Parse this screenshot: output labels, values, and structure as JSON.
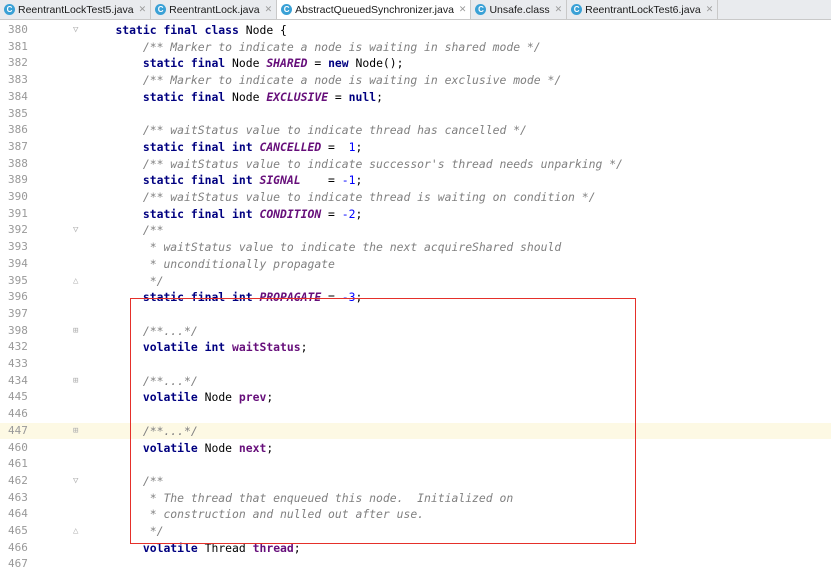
{
  "tabs": [
    {
      "label": "ReentrantLockTest5.java",
      "icon": "class-icon",
      "icon_letter": "C",
      "icon_color": "#3aa1d6",
      "active": false
    },
    {
      "label": "ReentrantLock.java",
      "icon": "class-icon",
      "icon_letter": "C",
      "icon_color": "#3aa1d6",
      "active": false
    },
    {
      "label": "AbstractQueuedSynchronizer.java",
      "icon": "class-icon",
      "icon_letter": "C",
      "icon_color": "#3aa1d6",
      "active": true
    },
    {
      "label": "Unsafe.class",
      "icon": "class-icon",
      "icon_letter": "C",
      "icon_color": "#3aa1d6",
      "active": false
    },
    {
      "label": "ReentrantLockTest6.java",
      "icon": "class-icon",
      "icon_letter": "C",
      "icon_color": "#3aa1d6",
      "active": false
    }
  ],
  "colors": {
    "keyword": "#000080",
    "comment": "#808080",
    "field": "#660e7a",
    "number": "#0000ff",
    "line_number": "#999999",
    "current_line": "#fdf9e4",
    "annotation_box": "#e5302a"
  },
  "lines": [
    {
      "num": "380",
      "fold": "open",
      "highlight": false,
      "tokens": [
        [
          "pl",
          "    "
        ],
        [
          "kw",
          "static final class"
        ],
        [
          "pl",
          " Node {"
        ]
      ]
    },
    {
      "num": "381",
      "fold": "",
      "highlight": false,
      "tokens": [
        [
          "pl",
          "        "
        ],
        [
          "cm",
          "/** Marker to indicate a node is waiting in shared mode */"
        ]
      ]
    },
    {
      "num": "382",
      "fold": "",
      "highlight": false,
      "tokens": [
        [
          "pl",
          "        "
        ],
        [
          "kw",
          "static final"
        ],
        [
          "pl",
          " Node "
        ],
        [
          "fs",
          "SHARED"
        ],
        [
          "pl",
          " = "
        ],
        [
          "kw",
          "new"
        ],
        [
          "pl",
          " Node();"
        ]
      ]
    },
    {
      "num": "383",
      "fold": "",
      "highlight": false,
      "tokens": [
        [
          "pl",
          "        "
        ],
        [
          "cm",
          "/** Marker to indicate a node is waiting in exclusive mode */"
        ]
      ]
    },
    {
      "num": "384",
      "fold": "",
      "highlight": false,
      "tokens": [
        [
          "pl",
          "        "
        ],
        [
          "kw",
          "static final"
        ],
        [
          "pl",
          " Node "
        ],
        [
          "fs",
          "EXCLUSIVE"
        ],
        [
          "pl",
          " = "
        ],
        [
          "kw",
          "null"
        ],
        [
          "pl",
          ";"
        ]
      ]
    },
    {
      "num": "385",
      "fold": "",
      "highlight": false,
      "tokens": []
    },
    {
      "num": "386",
      "fold": "",
      "highlight": false,
      "tokens": [
        [
          "pl",
          "        "
        ],
        [
          "cm",
          "/** waitStatus value to indicate thread has cancelled */"
        ]
      ]
    },
    {
      "num": "387",
      "fold": "",
      "highlight": false,
      "tokens": [
        [
          "pl",
          "        "
        ],
        [
          "kw",
          "static final int"
        ],
        [
          "pl",
          " "
        ],
        [
          "fs",
          "CANCELLED"
        ],
        [
          "pl",
          " =  "
        ],
        [
          "nm",
          "1"
        ],
        [
          "pl",
          ";"
        ]
      ]
    },
    {
      "num": "388",
      "fold": "",
      "highlight": false,
      "tokens": [
        [
          "pl",
          "        "
        ],
        [
          "cm",
          "/** waitStatus value to indicate successor's thread needs unparking */"
        ]
      ]
    },
    {
      "num": "389",
      "fold": "",
      "highlight": false,
      "tokens": [
        [
          "pl",
          "        "
        ],
        [
          "kw",
          "static final int"
        ],
        [
          "pl",
          " "
        ],
        [
          "fs",
          "SIGNAL"
        ],
        [
          "pl",
          "    = "
        ],
        [
          "nm",
          "-1"
        ],
        [
          "pl",
          ";"
        ]
      ]
    },
    {
      "num": "390",
      "fold": "",
      "highlight": false,
      "tokens": [
        [
          "pl",
          "        "
        ],
        [
          "cm",
          "/** waitStatus value to indicate thread is waiting on condition */"
        ]
      ]
    },
    {
      "num": "391",
      "fold": "",
      "highlight": false,
      "tokens": [
        [
          "pl",
          "        "
        ],
        [
          "kw",
          "static final int"
        ],
        [
          "pl",
          " "
        ],
        [
          "fs",
          "CONDITION"
        ],
        [
          "pl",
          " = "
        ],
        [
          "nm",
          "-2"
        ],
        [
          "pl",
          ";"
        ]
      ]
    },
    {
      "num": "392",
      "fold": "open",
      "highlight": false,
      "tokens": [
        [
          "pl",
          "        "
        ],
        [
          "cm",
          "/**"
        ]
      ]
    },
    {
      "num": "393",
      "fold": "",
      "highlight": false,
      "tokens": [
        [
          "pl",
          "         "
        ],
        [
          "cm",
          "* waitStatus value to indicate the next acquireShared should"
        ]
      ]
    },
    {
      "num": "394",
      "fold": "",
      "highlight": false,
      "tokens": [
        [
          "pl",
          "         "
        ],
        [
          "cm",
          "* unconditionally propagate"
        ]
      ]
    },
    {
      "num": "395",
      "fold": "close",
      "highlight": false,
      "tokens": [
        [
          "pl",
          "         "
        ],
        [
          "cm",
          "*/"
        ]
      ]
    },
    {
      "num": "396",
      "fold": "",
      "highlight": false,
      "tokens": [
        [
          "pl",
          "        "
        ],
        [
          "kw",
          "static final int"
        ],
        [
          "pl",
          " "
        ],
        [
          "fs",
          "PROPAGATE"
        ],
        [
          "pl",
          " = "
        ],
        [
          "nm",
          "-3"
        ],
        [
          "pl",
          ";"
        ]
      ]
    },
    {
      "num": "397",
      "fold": "",
      "highlight": false,
      "tokens": []
    },
    {
      "num": "398",
      "fold": "plus",
      "highlight": false,
      "tokens": [
        [
          "pl",
          "        "
        ],
        [
          "cm",
          "/**...*/"
        ]
      ]
    },
    {
      "num": "432",
      "fold": "",
      "highlight": false,
      "tokens": [
        [
          "pl",
          "        "
        ],
        [
          "kw",
          "volatile int"
        ],
        [
          "pl",
          " "
        ],
        [
          "fi",
          "waitStatus"
        ],
        [
          "pl",
          ";"
        ]
      ]
    },
    {
      "num": "433",
      "fold": "",
      "highlight": false,
      "tokens": []
    },
    {
      "num": "434",
      "fold": "plus",
      "highlight": false,
      "tokens": [
        [
          "pl",
          "        "
        ],
        [
          "cm",
          "/**...*/"
        ]
      ]
    },
    {
      "num": "445",
      "fold": "",
      "highlight": false,
      "tokens": [
        [
          "pl",
          "        "
        ],
        [
          "kw",
          "volatile"
        ],
        [
          "pl",
          " Node "
        ],
        [
          "fi",
          "prev"
        ],
        [
          "pl",
          ";"
        ]
      ]
    },
    {
      "num": "446",
      "fold": "",
      "highlight": false,
      "tokens": []
    },
    {
      "num": "447",
      "fold": "plus",
      "highlight": true,
      "tokens": [
        [
          "pl",
          "        "
        ],
        [
          "cm",
          "/**...*/"
        ]
      ]
    },
    {
      "num": "460",
      "fold": "",
      "highlight": false,
      "tokens": [
        [
          "pl",
          "        "
        ],
        [
          "kw",
          "volatile"
        ],
        [
          "pl",
          " Node "
        ],
        [
          "fi",
          "next"
        ],
        [
          "pl",
          ";"
        ]
      ]
    },
    {
      "num": "461",
      "fold": "",
      "highlight": false,
      "tokens": []
    },
    {
      "num": "462",
      "fold": "open",
      "highlight": false,
      "tokens": [
        [
          "pl",
          "        "
        ],
        [
          "cm",
          "/**"
        ]
      ]
    },
    {
      "num": "463",
      "fold": "",
      "highlight": false,
      "tokens": [
        [
          "pl",
          "         "
        ],
        [
          "cm",
          "* The thread that enqueued this node.  Initialized on"
        ]
      ]
    },
    {
      "num": "464",
      "fold": "",
      "highlight": false,
      "tokens": [
        [
          "pl",
          "         "
        ],
        [
          "cm",
          "* construction and nulled out after use."
        ]
      ]
    },
    {
      "num": "465",
      "fold": "close",
      "highlight": false,
      "tokens": [
        [
          "pl",
          "         "
        ],
        [
          "cm",
          "*/"
        ]
      ]
    },
    {
      "num": "466",
      "fold": "",
      "highlight": false,
      "tokens": [
        [
          "pl",
          "        "
        ],
        [
          "kw",
          "volatile"
        ],
        [
          "pl",
          " Thread "
        ],
        [
          "fi",
          "thread"
        ],
        [
          "pl",
          ";"
        ]
      ]
    },
    {
      "num": "467",
      "fold": "",
      "highlight": false,
      "tokens": []
    }
  ]
}
